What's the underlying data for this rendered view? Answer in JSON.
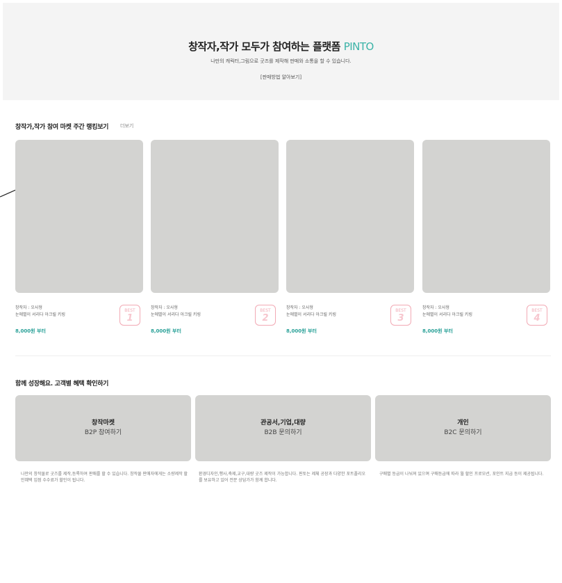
{
  "hero": {
    "title": "창작자,작가 모두가 참여하는 플랫폼 ",
    "brand": "PINTO",
    "subtitle": "나만의 캐릭터,그림으로 굿즈를 제작해 판매와 소통을 할 수 있습니다.",
    "link": "[판매방법 알아보기]"
  },
  "ranking": {
    "heading": "창작가,작가 참여 마켓 주간 랭킹보기",
    "more": "더보기",
    "items": [
      {
        "author": "창작자 : 오사형",
        "name": "눈에별이 서리다 아크릴 키링",
        "price": "8,000원 부터",
        "badge_label": "BEST",
        "rank": "1"
      },
      {
        "author": "창작자 : 오사형",
        "name": "눈에별이 서리다 아크릴 키링",
        "price": "8,000원 부터",
        "badge_label": "BEST",
        "rank": "2"
      },
      {
        "author": "창작자 : 오사형",
        "name": "눈에별이 서리다 아크릴 키링",
        "price": "8,000원 부터",
        "badge_label": "BEST",
        "rank": "3"
      },
      {
        "author": "창작자 : 오사형",
        "name": "눈에별이 서리다 아크릴 키링",
        "price": "8,000원 부터",
        "badge_label": "BEST",
        "rank": "4"
      }
    ]
  },
  "grow": {
    "heading_bold": "함께 성장해요.",
    "heading_rest": " 고객별 혜택 확인하기",
    "services": [
      {
        "title": "창작마켓",
        "sub": "B2P 참여하기",
        "desc": "나만의 창작물로 굿즈를 제작,등록하여 판매를 할 수 있습니다. 창작물 판매자에게는 소량제작 할인혜택 입점 수수료가 할인이 됩니다."
      },
      {
        "title": "관공서,기업,대량",
        "sub": "B2B 문의하기",
        "desc": "환경디자인,행사,축제,교구,대량 굿즈 제작이 가능합니다. 핀토는 제체 공장과 다양한 포트폴리오를 보유하고 있어 전문 상담가가 함께 합니다."
      },
      {
        "title": "개인",
        "sub": "B2C 문의하기",
        "desc": "구매별 등급이 나눠져 있으며 구매등급에 따라 월 할인 프로모션, 포인트 지급 등이 제공됩니다."
      }
    ]
  },
  "colors": {
    "brand": "#3bb3a7",
    "price": "#2aa198",
    "badge": "#f2a9b4",
    "placeholder": "#d3d3d1",
    "hero_bg": "#f4f4f4"
  }
}
